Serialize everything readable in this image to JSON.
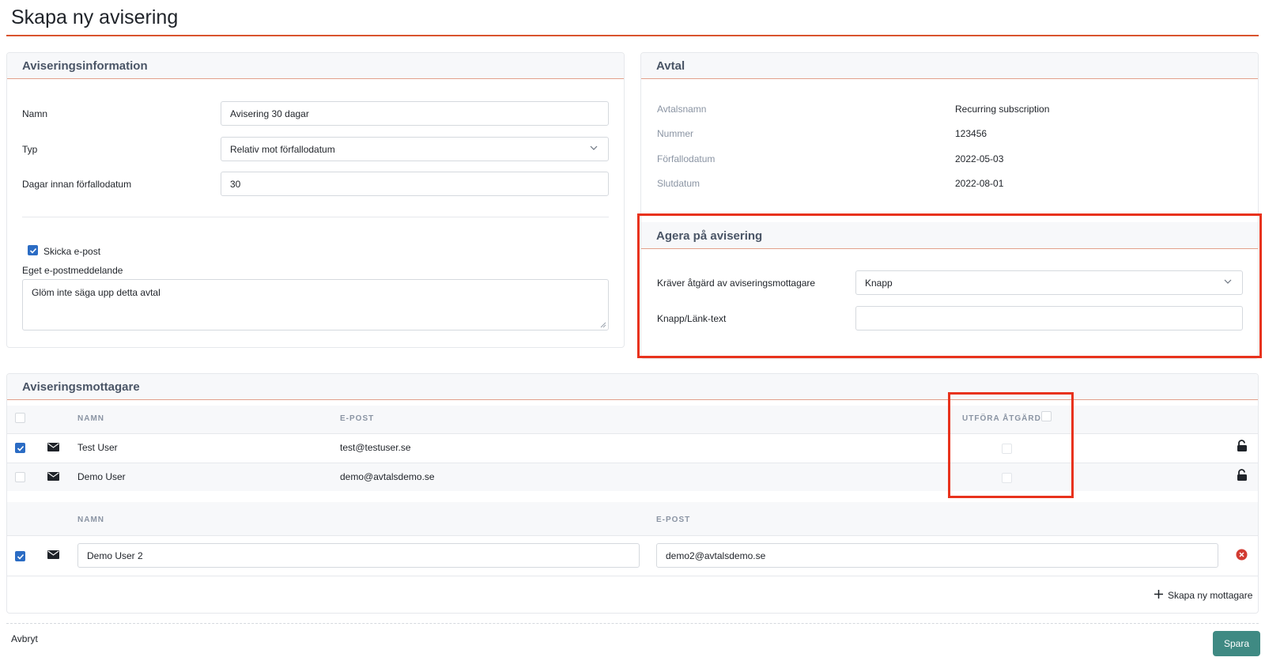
{
  "page": {
    "title": "Skapa ny avisering"
  },
  "notice_info": {
    "heading": "Aviseringsinformation",
    "name_label": "Namn",
    "name_value": "Avisering 30 dagar",
    "type_label": "Typ",
    "type_value": "Relativ mot förfallodatum",
    "days_label": "Dagar innan förfallodatum",
    "days_value": "30",
    "send_email_label": "Skicka e-post",
    "send_email_checked": true,
    "custom_message_label": "Eget e-postmeddelande",
    "custom_message_value": "Glöm inte säga upp detta avtal"
  },
  "contract": {
    "heading": "Avtal",
    "rows": [
      {
        "label": "Avtalsnamn",
        "value": "Recurring subscription"
      },
      {
        "label": "Nummer",
        "value": "123456"
      },
      {
        "label": "Förfallodatum",
        "value": "2022-05-03"
      },
      {
        "label": "Slutdatum",
        "value": "2022-08-01"
      }
    ]
  },
  "act_on_notice": {
    "heading": "Agera på avisering",
    "requires_label": "Kräver åtgärd av aviseringsmottagare",
    "requires_value": "Knapp",
    "link_text_label": "Knapp/Länk-text",
    "link_text_value": ""
  },
  "recipients": {
    "heading": "Aviseringsmottagare",
    "columns": {
      "name": "NAMN",
      "email": "E-POST",
      "action": "UTFÖRA ÅTGÄRD"
    },
    "rows": [
      {
        "selected": true,
        "name": "Test User",
        "email": "test@testuser.se",
        "action": false
      },
      {
        "selected": false,
        "name": "Demo User",
        "email": "demo@avtalsdemo.se",
        "action": false
      }
    ],
    "new_columns": {
      "name": "NAMN",
      "email": "E-POST"
    },
    "new_rows": [
      {
        "selected": true,
        "name": "Demo User 2",
        "email": "demo2@avtalsdemo.se"
      }
    ],
    "add_label": "Skapa ny mottagare"
  },
  "footer": {
    "cancel_label": "Avbryt",
    "save_label": "Spara"
  },
  "colors": {
    "accent": "#d9542e",
    "highlight": "#e8321c",
    "primary_button": "#3f8a83",
    "checkbox": "#2b6cc4",
    "remove": "#d23b32"
  }
}
